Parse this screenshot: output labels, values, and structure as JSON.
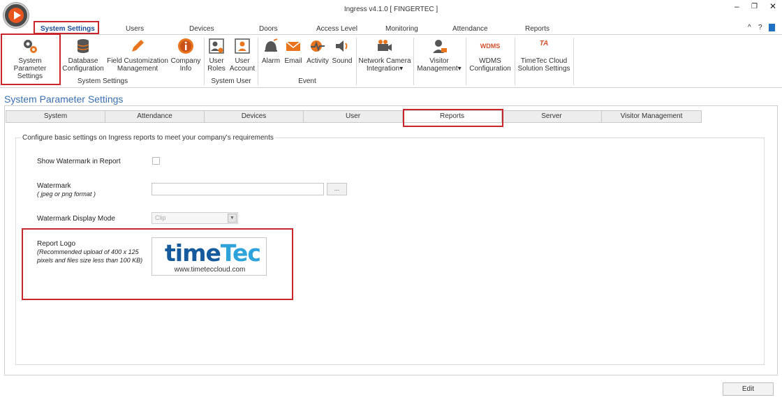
{
  "window": {
    "title": "Ingress v4.1.0 [ FINGERTEC ]",
    "controls": {
      "minimize": "–",
      "restore": "❐",
      "close": "✕"
    }
  },
  "menu_tabs": [
    {
      "label": "System Settings",
      "active": true
    },
    {
      "label": "Users"
    },
    {
      "label": "Devices"
    },
    {
      "label": "Doors"
    },
    {
      "label": "Access Level"
    },
    {
      "label": "Monitoring"
    },
    {
      "label": "Attendance"
    },
    {
      "label": "Reports"
    }
  ],
  "ribbon_right": {
    "collapse": "^",
    "help": "?"
  },
  "ribbon": {
    "system_parameter": "System Parameter Settings",
    "database": "Database Configuration",
    "field_customization": "Field Customization Management",
    "company_info": "Company Info",
    "user_roles": "User Roles",
    "user_account": "User Account",
    "alarm": "Alarm",
    "email": "Email",
    "activity": "Activity",
    "sound": "Sound",
    "network_camera": "Network Camera Integration",
    "visitor_management": "Visitor Management",
    "wdms_config": "WDMS Configuration",
    "wdms_logo_text": "WDMS",
    "timetec_cloud": "TimeTec Cloud Solution Settings",
    "ta_logo_text": "TA",
    "groups": {
      "system_settings": "System Settings",
      "system_user": "System User",
      "event": "Event"
    }
  },
  "page": {
    "title": "System Parameter Settings",
    "tabs": [
      {
        "label": "System"
      },
      {
        "label": "Attendance"
      },
      {
        "label": "Devices"
      },
      {
        "label": "User"
      },
      {
        "label": "Reports",
        "active": true
      },
      {
        "label": "Server"
      },
      {
        "label": "Visitor Management"
      }
    ],
    "group_caption": "Configure basic settings on Ingress reports to meet your company's requirements",
    "show_watermark_label": "Show Watermark in Report",
    "show_watermark_checked": false,
    "watermark_label": "Watermark",
    "watermark_hint": "( jpeg or png format )",
    "watermark_value": "",
    "browse_label": "...",
    "display_mode_label": "Watermark Display Mode",
    "display_mode_value": "Clip",
    "report_logo_label": "Report Logo",
    "report_logo_hint_1": "(Recommended upload of 400 x 125",
    "report_logo_hint_2": "pixels and files size less than 100 KB)",
    "logo_text_a": "time",
    "logo_text_b": "Tec",
    "logo_url": "www.timeteccloud.com",
    "edit_button": "Edit"
  }
}
